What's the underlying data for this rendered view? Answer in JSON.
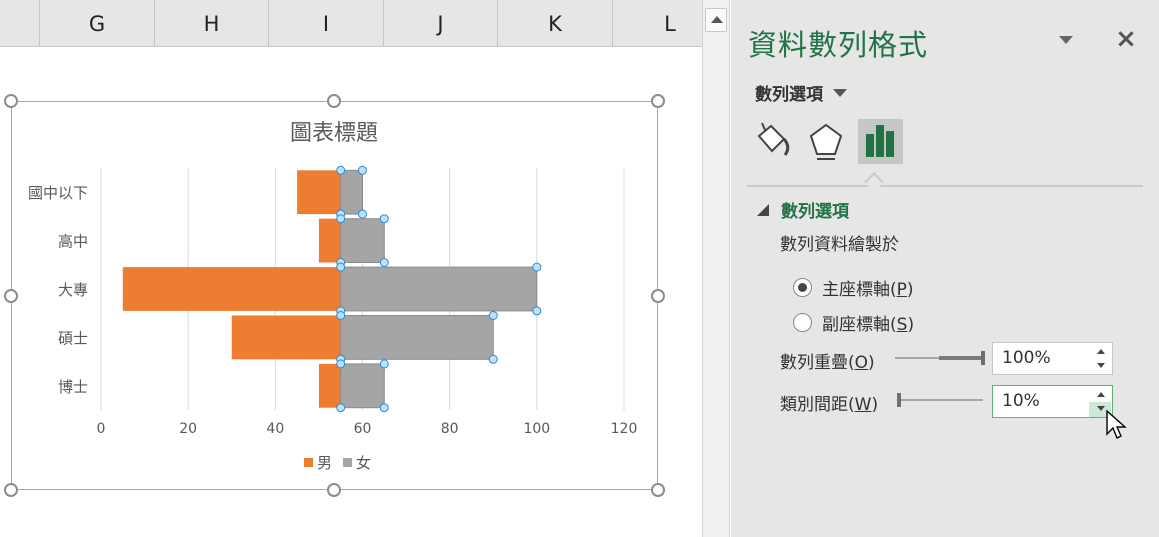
{
  "sheet": {
    "columns": [
      {
        "label": "G"
      },
      {
        "label": "H"
      },
      {
        "label": "I"
      },
      {
        "label": "J"
      },
      {
        "label": "K"
      },
      {
        "label": "L"
      }
    ]
  },
  "chart": {
    "title": "圖表標題"
  },
  "chart_data": {
    "type": "bar",
    "orientation": "horizontal",
    "stacked": true,
    "title": "圖表標題",
    "categories": [
      "國中以下",
      "高中",
      "大專",
      "碩士",
      "博士"
    ],
    "series": [
      {
        "name": "男",
        "color": "#ED7D31",
        "start": [
          45,
          50,
          5,
          30,
          50
        ],
        "end": [
          55,
          55,
          55,
          55,
          55
        ]
      },
      {
        "name": "女",
        "color": "#A5A5A5",
        "start": [
          55,
          55,
          55,
          55,
          55
        ],
        "end": [
          60,
          65,
          100,
          90,
          65
        ]
      }
    ],
    "x_ticks": [
      0,
      20,
      40,
      60,
      80,
      100,
      120
    ],
    "xlim": [
      0,
      120
    ],
    "legend_position": "bottom",
    "grid": true,
    "selected_series": "女"
  },
  "pane": {
    "title": "資料數列格式",
    "options_dropdown": "數列選項",
    "tabs": [
      {
        "name": "fill-line",
        "icon": "paint-bucket-icon"
      },
      {
        "name": "effects",
        "icon": "pentagon-icon"
      },
      {
        "name": "series-options",
        "icon": "bar-chart-icon",
        "active": true
      }
    ],
    "section_title": "數列選項",
    "plot_on_label": "數列資料繪製於",
    "radio_primary": "主座標軸(",
    "radio_primary_key": "P",
    "radio_primary_end": ")",
    "radio_secondary": "副座標軸(",
    "radio_secondary_key": "S",
    "radio_secondary_end": ")",
    "overlap_label": "數列重疊(",
    "overlap_key": "O",
    "overlap_end": ")",
    "overlap_value": "100%",
    "overlap_fraction": 1.0,
    "gap_label": "類別間距(",
    "gap_key": "W",
    "gap_end": ")",
    "gap_value": "10%",
    "gap_fraction": 0.02,
    "accent_color": "#217346"
  }
}
